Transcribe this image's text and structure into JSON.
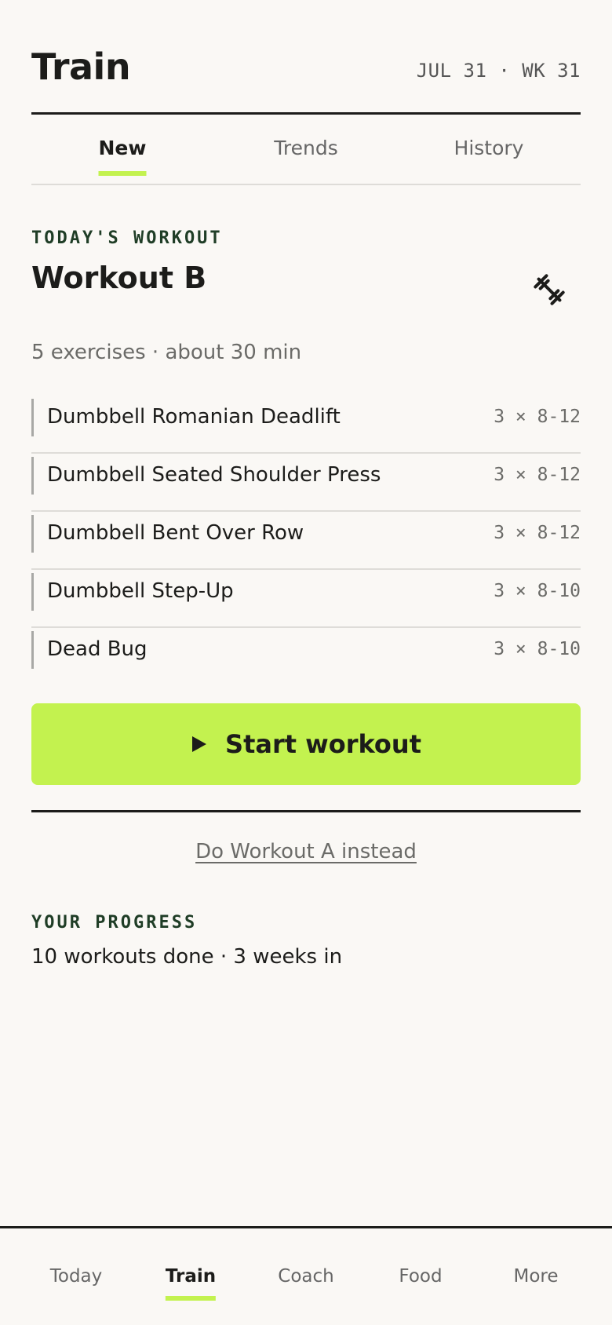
{
  "header": {
    "title": "Train",
    "date_badge": "JUL 31 · WK 31"
  },
  "tabs": [
    {
      "label": "New",
      "active": true
    },
    {
      "label": "Trends",
      "active": false
    },
    {
      "label": "History",
      "active": false
    }
  ],
  "today": {
    "section_label": "TODAY'S WORKOUT",
    "workout_name": "Workout B",
    "icon": "dumbbell-icon",
    "summary": "5 exercises · about 30 min",
    "exercises": [
      {
        "name": "Dumbbell Romanian Deadlift",
        "sets": "3 × 8-12"
      },
      {
        "name": "Dumbbell Seated Shoulder Press",
        "sets": "3 × 8-12"
      },
      {
        "name": "Dumbbell Bent Over Row",
        "sets": "3 × 8-12"
      },
      {
        "name": "Dumbbell Step-Up",
        "sets": "3 × 8-10"
      },
      {
        "name": "Dead Bug",
        "sets": "3 × 8-10"
      }
    ],
    "start_button": "Start workout",
    "alt_link": "Do Workout A instead"
  },
  "progress": {
    "section_label": "YOUR PROGRESS",
    "text": "10 workouts done · 3 weeks in"
  },
  "bottom_nav": [
    {
      "label": "Today",
      "active": false
    },
    {
      "label": "Train",
      "active": true
    },
    {
      "label": "Coach",
      "active": false
    },
    {
      "label": "Food",
      "active": false
    },
    {
      "label": "More",
      "active": false
    }
  ],
  "colors": {
    "accent": "#c3f24f",
    "background": "#faf8f5",
    "text": "#1c1c1a",
    "label_green": "#1f3d26"
  }
}
